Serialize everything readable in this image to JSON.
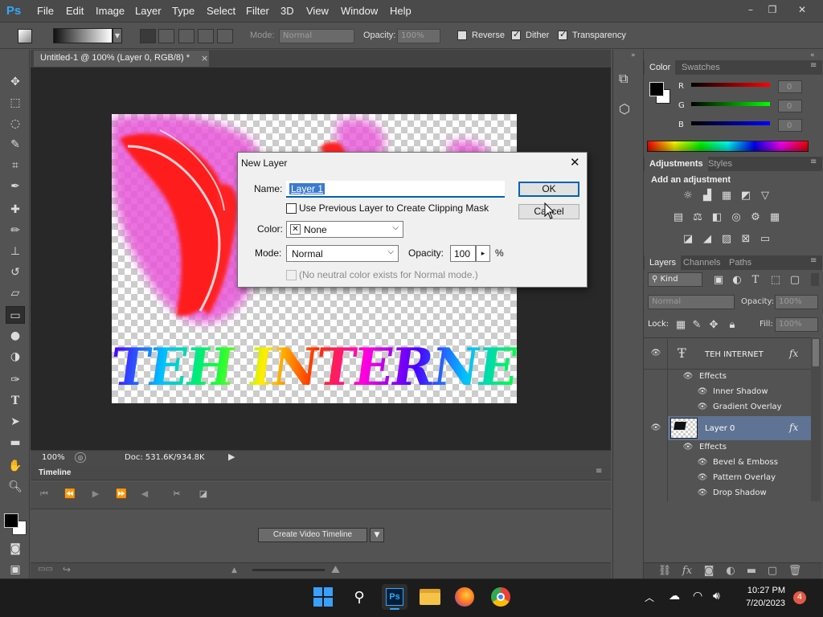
{
  "app": {
    "logo": "Ps",
    "window_controls": [
      "–",
      "❐",
      "✕"
    ]
  },
  "menu": [
    "File",
    "Edit",
    "Image",
    "Layer",
    "Type",
    "Select",
    "Filter",
    "3D",
    "View",
    "Window",
    "Help"
  ],
  "options": {
    "mode_label": "Mode:",
    "mode_value": "Normal",
    "opacity_label": "Opacity:",
    "opacity_value": "100%",
    "reverse_label": "Reverse",
    "dither_label": "Dither",
    "transparency_label": "Transparency",
    "reverse_checked": false,
    "dither_checked": true,
    "transparency_checked": true
  },
  "document": {
    "tab_title": "Untitled-1 @ 100% (Layer 0, RGB/8) *",
    "tab_close": "×",
    "canvas_text": "TEH INTERNET",
    "zoom": "100%",
    "doc_size": "Doc: 531.6K/934.8K"
  },
  "timeline": {
    "title": "Timeline",
    "create_button": "Create Video Timeline"
  },
  "color_panel": {
    "tabs": [
      "Color",
      "Swatches"
    ],
    "channels": [
      {
        "label": "R",
        "value": "0",
        "color": "#d02020"
      },
      {
        "label": "G",
        "value": "0",
        "color": "#20b020"
      },
      {
        "label": "B",
        "value": "0",
        "color": "#2050e0"
      }
    ]
  },
  "adjustments_panel": {
    "tabs": [
      "Adjustments",
      "Styles"
    ],
    "heading": "Add an adjustment"
  },
  "layers_panel": {
    "tabs": [
      "Layers",
      "Channels",
      "Paths"
    ],
    "kind_label": "Kind",
    "blend_mode": "Normal",
    "opacity_label": "Opacity:",
    "opacity_value": "100%",
    "lock_label": "Lock:",
    "fill_label": "Fill:",
    "fill_value": "100%",
    "layers": [
      {
        "name": "TEH INTERNET",
        "fx": "fx",
        "effects_label": "Effects",
        "effects": [
          "Inner Shadow",
          "Gradient Overlay"
        ],
        "selected": false
      },
      {
        "name": "Layer 0",
        "fx": "fx",
        "effects_label": "Effects",
        "effects": [
          "Bevel & Emboss",
          "Pattern Overlay",
          "Drop Shadow"
        ],
        "selected": true
      }
    ]
  },
  "dialog": {
    "title": "New Layer",
    "name_label": "Name:",
    "name_value": "Layer 1",
    "clipping_label": "Use Previous Layer to Create Clipping Mask",
    "color_label": "Color:",
    "color_value": "None",
    "mode_label": "Mode:",
    "mode_value": "Normal",
    "opacity_label": "Opacity:",
    "opacity_value": "100",
    "percent": "%",
    "neutral_label": "(No neutral color exists for Normal mode.)",
    "ok_label": "OK",
    "cancel_label": "Cancel"
  },
  "taskbar": {
    "time": "10:27 PM",
    "date": "7/20/2023",
    "notifications": "4",
    "ps_label": "Ps"
  }
}
